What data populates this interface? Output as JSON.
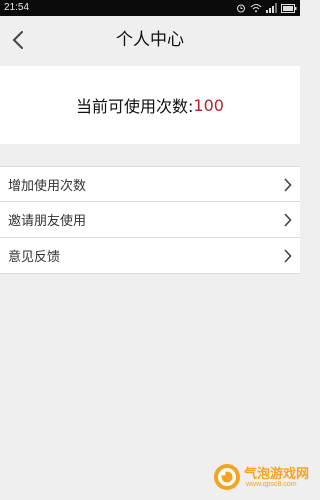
{
  "status_bar": {
    "time": "21:54",
    "icons": [
      "alarm-icon",
      "wifi-icon",
      "signal-icon",
      "battery-icon"
    ]
  },
  "header": {
    "title": "个人中心",
    "back_icon": "chevron-left-icon"
  },
  "usage": {
    "label": "当前可使用次数:",
    "value": "100",
    "value_color": "#b3252a"
  },
  "menu": {
    "items": [
      {
        "label": "增加使用次数",
        "icon": "chevron-right-icon"
      },
      {
        "label": "邀请朋友使用",
        "icon": "chevron-right-icon"
      },
      {
        "label": "意见反馈",
        "icon": "chevron-right-icon"
      }
    ]
  },
  "watermark": {
    "brand": "气泡游戏网",
    "url": "www.qpsc8.com",
    "color": "#f5a320"
  }
}
